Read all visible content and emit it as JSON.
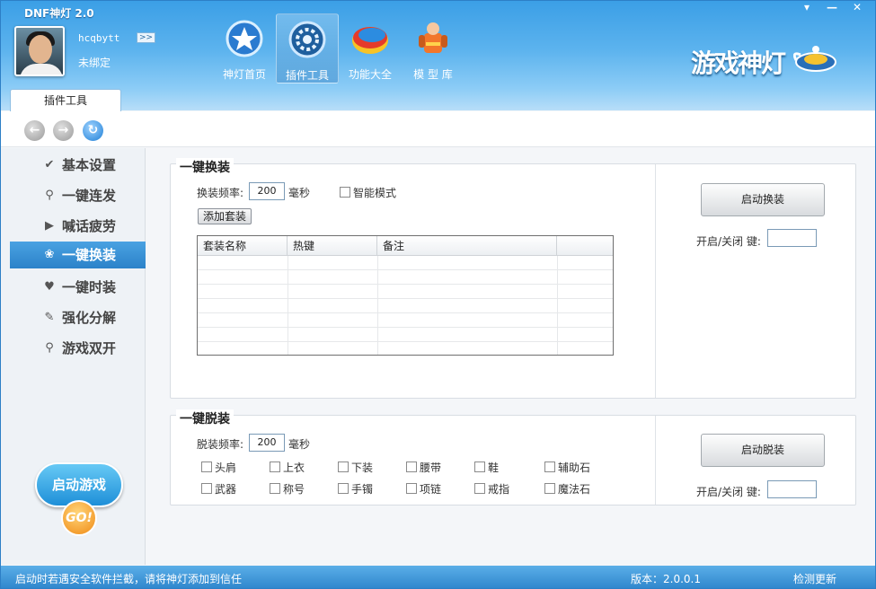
{
  "app": {
    "title": "DNF神灯 2.0",
    "brand": "游戏神灯"
  },
  "window_buttons": {
    "menu": "▾",
    "minimize": "—",
    "close": "✕"
  },
  "user": {
    "name": "hcqbytt",
    "expand": ">>",
    "status": "未绑定"
  },
  "nav": [
    {
      "label": "神灯首页",
      "icon": "star-icon"
    },
    {
      "label": "插件工具",
      "icon": "gear-icon"
    },
    {
      "label": "功能大全",
      "icon": "globe-icon"
    },
    {
      "label": "模 型 库",
      "icon": "character-icon"
    }
  ],
  "tab": {
    "label": "插件工具"
  },
  "sidebar": {
    "items": [
      {
        "label": "基本设置",
        "icon": "check-icon"
      },
      {
        "label": "一键连发",
        "icon": "search-icon"
      },
      {
        "label": "喊话疲劳",
        "icon": "play-icon"
      },
      {
        "label": "一键换装",
        "icon": "paw-icon"
      },
      {
        "label": "一键时装",
        "icon": "heart-icon"
      },
      {
        "label": "强化分解",
        "icon": "wrench-icon"
      },
      {
        "label": "游戏双开",
        "icon": "search-icon"
      }
    ],
    "active_index": 3,
    "start_game": {
      "label": "启动游戏",
      "go": "GO!"
    }
  },
  "equip": {
    "title": "一键换装",
    "freq_label": "换装频率:",
    "freq_value": "200",
    "unit": "毫秒",
    "smart_mode": "智能模式",
    "add_button": "添加套装",
    "columns": [
      "套装名称",
      "热键",
      "备注"
    ],
    "start_button": "启动换装",
    "hotkey_label": "开启/关闭 键:",
    "hotkey_value": ""
  },
  "unequip": {
    "title": "一键脱装",
    "freq_label": "脱装频率:",
    "freq_value": "200",
    "unit": "毫秒",
    "slots_row1": [
      "头肩",
      "上衣",
      "下装",
      "腰带",
      "鞋",
      "辅助石"
    ],
    "slots_row2": [
      "武器",
      "称号",
      "手镯",
      "项链",
      "戒指",
      "魔法石"
    ],
    "start_button": "启动脱装",
    "hotkey_label": "开启/关闭 键:",
    "hotkey_value": ""
  },
  "status": {
    "message": "启动时若遇安全软件拦截，请将神灯添加到信任",
    "version": "版本：2.0.0.1",
    "update": "检测更新"
  }
}
